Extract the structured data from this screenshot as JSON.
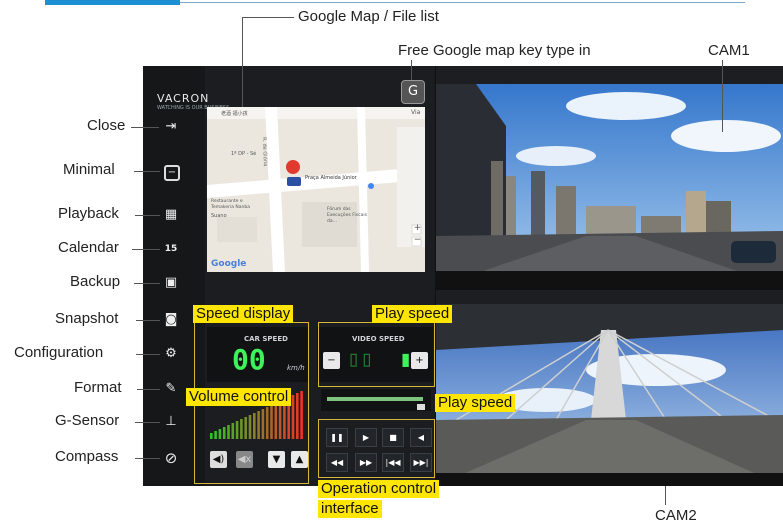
{
  "annotations": {
    "google_map_file_list": "Google Map / File list",
    "free_key": "Free Google map key type in",
    "cam1": "CAM1",
    "cam2": "CAM2",
    "speed_display": "Speed display",
    "play_speed": "Play speed",
    "volume_control": "Volume control",
    "play_speed_2": "Play speed",
    "operation_control": "Operation control",
    "interface": "interface"
  },
  "sidebar": {
    "items": [
      {
        "label": "Close"
      },
      {
        "label": "Minimal"
      },
      {
        "label": "Playback"
      },
      {
        "label": "Calendar"
      },
      {
        "label": "Backup"
      },
      {
        "label": "Snapshot"
      },
      {
        "label": "Configuration"
      },
      {
        "label": "Format"
      },
      {
        "label": "G-Sensor"
      },
      {
        "label": "Compass"
      }
    ]
  },
  "app": {
    "logo": "VACRON",
    "map": {
      "place": "Praça Almeida Júnior",
      "label_top": "老酒 福小孩",
      "label_dp": "1º DP - Sé",
      "label_rest": "Restaurante e Temakeria Nanba",
      "label_suano": "Suano",
      "label_forum": "Fórum das Execuções Fiscais da...",
      "label_via": "Via",
      "street": "R. da Glória",
      "google": "Google",
      "zoom_in": "+",
      "zoom_out": "−"
    },
    "car_speed": {
      "title": "CAR SPEED",
      "value": "00",
      "unit": "km/h"
    },
    "video_speed": {
      "title": "VIDEO SPEED",
      "minus": "−",
      "plus": "+"
    },
    "key_button": "G",
    "colors": {
      "accent": "#1f8fd4",
      "highlight": "#ffe600",
      "segment_green": "#3df25a"
    }
  }
}
